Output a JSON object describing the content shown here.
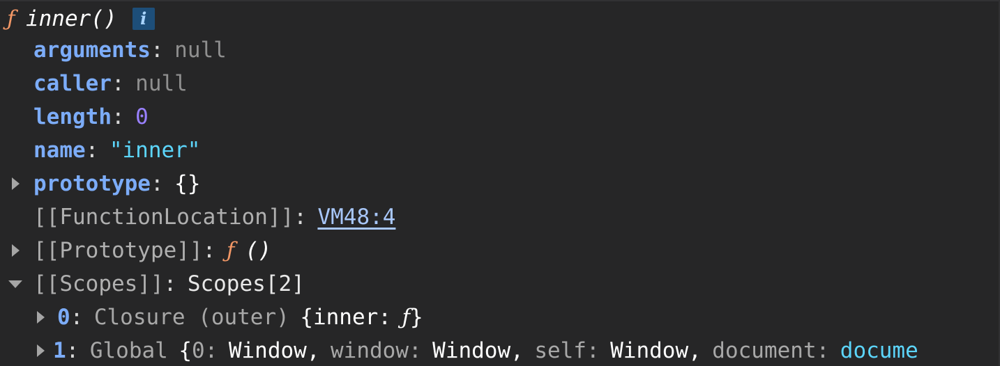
{
  "header": {
    "f_glyph": "ƒ",
    "func_signature": "inner()",
    "info_label": "i"
  },
  "props": {
    "arguments": {
      "key": "arguments",
      "value": "null"
    },
    "caller": {
      "key": "caller",
      "value": "null"
    },
    "length": {
      "key": "length",
      "value": "0"
    },
    "name": {
      "key": "name",
      "value": "\"inner\""
    },
    "prototype": {
      "key": "prototype",
      "value": "{}"
    },
    "function_location": {
      "key": "[[FunctionLocation]]",
      "value": "VM48:4"
    },
    "proto_internal": {
      "key": "[[Prototype]]",
      "f_glyph": "ƒ",
      "value": "()"
    },
    "scopes": {
      "key": "[[Scopes]]",
      "value": "Scopes[2]"
    }
  },
  "scopes": [
    {
      "index": "0",
      "type": "Closure (outer)",
      "open": "{",
      "entry_key": "inner",
      "entry_glyph": "ƒ",
      "close": "}"
    },
    {
      "index": "1",
      "type": "Global",
      "open": "{",
      "entries": [
        {
          "key": "0",
          "value": "Window"
        },
        {
          "key": "window",
          "value": "Window"
        },
        {
          "key": "self",
          "value": "Window"
        },
        {
          "key": "document",
          "value": "docume"
        }
      ]
    }
  ],
  "colors": {
    "background": "#262627",
    "property_key": "#7cacf8",
    "string_value": "#5cd5fb",
    "number_value": "#9980ff",
    "function_tag": "#f29766",
    "null_value": "#8f8f8f"
  }
}
